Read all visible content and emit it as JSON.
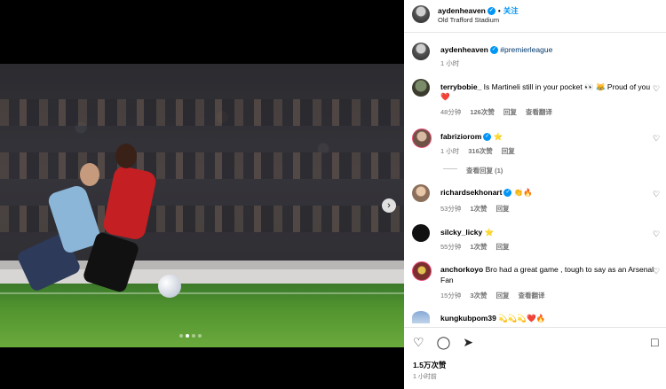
{
  "header": {
    "username": "aydenheaven",
    "follow_label": "关注",
    "location": "Old Trafford Stadium"
  },
  "caption": {
    "username": "aydenheaven",
    "hashtag": "#premierleague",
    "time": "1 小时"
  },
  "comments": [
    {
      "username": "terrybobie_",
      "text": "Is Martineli still in your pocket 👀 😹 Proud of you",
      "trailing": "❤️",
      "time": "48分钟",
      "likes": "126次赞",
      "reply": "回复",
      "translate": "查看翻译"
    },
    {
      "username": "fabriziorom",
      "text": "⭐",
      "time": "1 小时",
      "likes": "316次赞",
      "reply": "回复",
      "view_replies": "查看回复 (1)"
    },
    {
      "username": "richardsekhonart",
      "text": "👏🔥",
      "time": "53分钟",
      "likes": "1次赞",
      "reply": "回复"
    },
    {
      "username": "silcky_licky",
      "text": "⭐",
      "time": "55分钟",
      "likes": "1次赞",
      "reply": "回复"
    },
    {
      "username": "anchorkoyo",
      "text": "Bro had a great game , tough to say as an Arsenal",
      "text2": "Fan",
      "time": "15分钟",
      "likes": "3次赞",
      "reply": "回复",
      "translate": "查看翻译"
    },
    {
      "username": "kungkubpom39",
      "text": "💫💫💫❤️🔥"
    }
  ],
  "footer": {
    "likes": "1.5万次赞",
    "time": "1 小时前"
  },
  "icons": {
    "heart": "♡",
    "comment": "◯",
    "share": "➤",
    "bookmark": "🔖",
    "next": "›"
  },
  "colors": {
    "link": "#0095f6",
    "hashtag": "#00376b",
    "muted": "#737373"
  }
}
